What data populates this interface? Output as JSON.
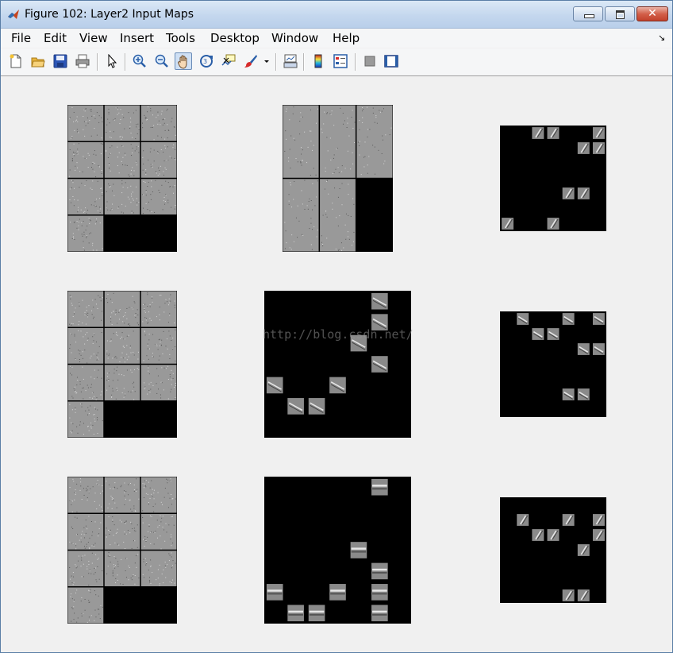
{
  "window": {
    "title": "Figure 102: Layer2 Input Maps",
    "close_glyph": "✕"
  },
  "menu": {
    "items": [
      "File",
      "Edit",
      "View",
      "Insert",
      "Tools",
      "Desktop",
      "Window",
      "Help"
    ],
    "dock_glyph": "↘"
  },
  "toolbar": {
    "buttons": [
      {
        "name": "new-figure-icon"
      },
      {
        "name": "open-file-icon"
      },
      {
        "name": "save-figure-icon"
      },
      {
        "name": "print-figure-icon"
      },
      {
        "name": "edit-plot-arrow-icon"
      },
      {
        "name": "zoom-in-icon"
      },
      {
        "name": "zoom-out-icon"
      },
      {
        "name": "pan-hand-icon",
        "active": true
      },
      {
        "name": "rotate-3d-icon"
      },
      {
        "name": "data-cursor-icon"
      },
      {
        "name": "brush-icon"
      },
      {
        "name": "link-plot-icon"
      },
      {
        "name": "insert-colorbar-icon"
      },
      {
        "name": "insert-legend-icon"
      },
      {
        "name": "hide-plot-tools-icon"
      },
      {
        "name": "show-plot-tools-icon"
      }
    ]
  },
  "colors": {
    "map_gray": "#999999",
    "map_black": "#000000",
    "grid_line": "#000000"
  },
  "watermark": "http://blog.csdn.net/",
  "maps": [
    {
      "kind": "grid",
      "cols": 3,
      "rows": 4,
      "filled": 10
    },
    {
      "kind": "grid",
      "cols": 3,
      "rows": 2,
      "filled": 5
    },
    {
      "kind": "sparse",
      "cells": 7,
      "orientation": "diag",
      "patches": [
        [
          2,
          0
        ],
        [
          3,
          0
        ],
        [
          6,
          0
        ],
        [
          5,
          1
        ],
        [
          6,
          1
        ],
        [
          4,
          4
        ],
        [
          5,
          4
        ],
        [
          0,
          6
        ],
        [
          3,
          6
        ]
      ]
    },
    {
      "kind": "grid",
      "cols": 3,
      "rows": 4,
      "filled": 10
    },
    {
      "kind": "sparse",
      "cells": 7,
      "orientation": "diag-down",
      "patches": [
        [
          5,
          0
        ],
        [
          5,
          1
        ],
        [
          4,
          2
        ],
        [
          5,
          3
        ],
        [
          0,
          4
        ],
        [
          3,
          4
        ],
        [
          1,
          5
        ],
        [
          2,
          5
        ]
      ]
    },
    {
      "kind": "sparse",
      "cells": 7,
      "orientation": "diag-down",
      "patches": [
        [
          1,
          0
        ],
        [
          4,
          0
        ],
        [
          6,
          0
        ],
        [
          2,
          1
        ],
        [
          3,
          1
        ],
        [
          5,
          2
        ],
        [
          6,
          2
        ],
        [
          4,
          5
        ],
        [
          5,
          5
        ]
      ]
    },
    {
      "kind": "grid",
      "cols": 3,
      "rows": 4,
      "filled": 10
    },
    {
      "kind": "sparse",
      "cells": 7,
      "orientation": "horizontal",
      "patches": [
        [
          5,
          0
        ],
        [
          4,
          3
        ],
        [
          5,
          4
        ],
        [
          0,
          5
        ],
        [
          3,
          5
        ],
        [
          5,
          5
        ],
        [
          5,
          6
        ],
        [
          1,
          6
        ],
        [
          2,
          6
        ]
      ]
    },
    {
      "kind": "sparse",
      "cells": 7,
      "orientation": "diag",
      "patches": [
        [
          1,
          1
        ],
        [
          4,
          1
        ],
        [
          6,
          1
        ],
        [
          2,
          2
        ],
        [
          3,
          2
        ],
        [
          6,
          2
        ],
        [
          5,
          3
        ],
        [
          4,
          6
        ],
        [
          5,
          6
        ]
      ]
    }
  ]
}
